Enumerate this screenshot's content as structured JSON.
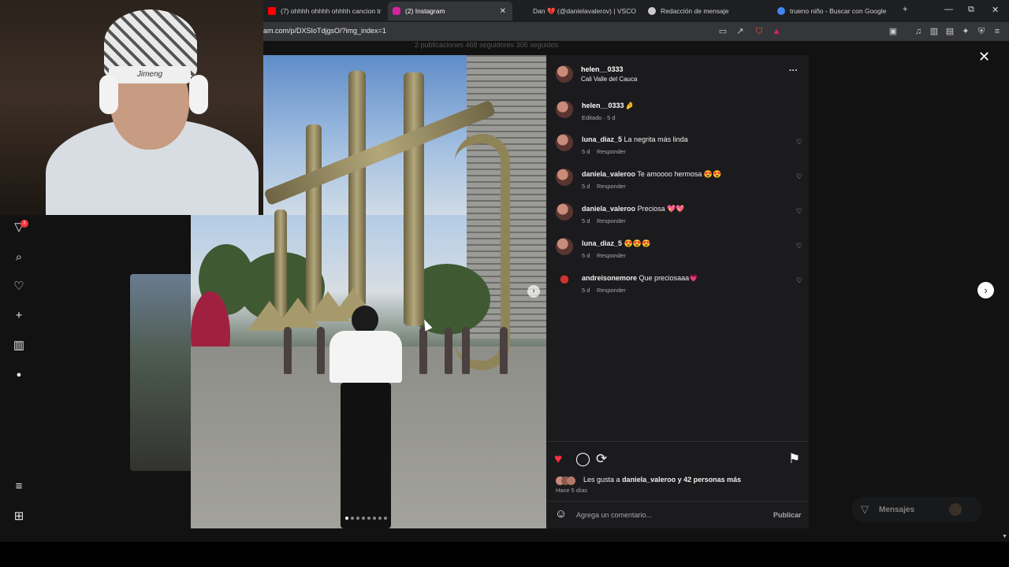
{
  "browser": {
    "tabs": [
      {
        "label": "(7) ohhhh ohhhh ohhhh cancion tris",
        "icon": "youtube-icon",
        "color": "#ff0000"
      },
      {
        "label": "(2) Instagram",
        "icon": "instagram-icon",
        "color": "#d6249f",
        "active": true
      },
      {
        "label": "Dan 💔 (@danielavalerov) | VSCO",
        "icon": "vsco-icon",
        "color": "#cccccc"
      },
      {
        "label": "Redacción de mensaje",
        "icon": "globe-icon",
        "color": "#cccccc"
      },
      {
        "label": "trueno niño - Buscar con Google",
        "icon": "google-icon",
        "color": "#4285f4"
      }
    ],
    "new_tab": "+",
    "window_controls": {
      "minimize": "—",
      "restore": "⧉",
      "close": "✕"
    },
    "url": "am.com/p/DXSIoTdjgsO/?img_index=1"
  },
  "profile_stats": "2 publicaciones   468 seguidores   306 seguidos",
  "webcam": {
    "headband_text": "Jimeng"
  },
  "nav": {
    "badge_count": "2",
    "icons": [
      "threads-icon",
      "search-icon",
      "heart-icon",
      "plus-icon",
      "insights-icon",
      "profile-icon",
      "menu-icon",
      "apps-icon"
    ]
  },
  "photo": {
    "carousel_count": 8,
    "active_index": 0,
    "next_symbol": "›"
  },
  "post": {
    "author": "helen__0333",
    "location": "Cali Valle del Cauca",
    "more": "···",
    "caption": {
      "user": "helen__0333",
      "text": "🤌",
      "meta": "Editado · 5 d"
    },
    "comments": [
      {
        "user": "luna_diaz_5",
        "text": "La negrita más linda",
        "age": "5 d",
        "reply": "Responder"
      },
      {
        "user": "daniela_valeroo",
        "text": "Te amoooo hermosa 😍😍",
        "age": "5 d",
        "reply": "Responder"
      },
      {
        "user": "daniela_valeroo",
        "text": "Preciosa 💖💖",
        "age": "5 d",
        "reply": "Responder"
      },
      {
        "user": "luna_diaz_5",
        "text": "😍😍😍",
        "age": "5 d",
        "reply": "Responder"
      },
      {
        "user": "andreisonemore",
        "text": "Que preciosaaa💗",
        "age": "5 d",
        "reply": "Responder"
      }
    ],
    "likes_prefix": "Les gusta a",
    "likes_user": "daniela_valeroo",
    "likes_suffix": "y 42 personas más",
    "posted": "Hace 5 días",
    "comment_placeholder": "Agrega un comentario...",
    "publish": "Publicar",
    "like_color": "#ff3040"
  },
  "messages": {
    "label": "Mensajes",
    "badge": "2"
  },
  "close_symbol": "✕",
  "next_symbol": "›"
}
